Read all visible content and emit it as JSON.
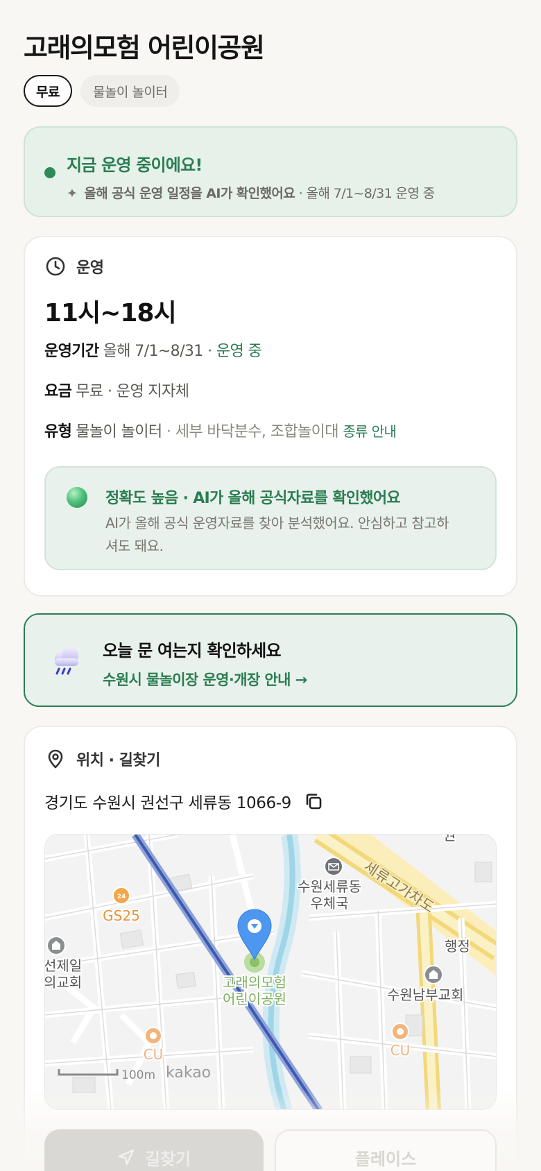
{
  "park": {
    "title": "고래의모험 어린이공원",
    "chips": [
      "무료",
      "물놀이 놀이터"
    ]
  },
  "status": {
    "title": "지금 운영 중이에요!",
    "sparkle": "✦",
    "sub_bold": "올해 공식 운영 일정을 AI가 확인했어요",
    "sub_rest": " · 올해 7/1~8/31 운영 중"
  },
  "operation": {
    "section_label": "운영",
    "hours": "11시~18시",
    "period_key": "운영기간",
    "period_value": "올해 7/1~8/31",
    "period_status": " · 운영 중",
    "fee_key": "요금",
    "fee_value": "무료 · 운영 지자체",
    "type_key": "유형",
    "type_value": "물놀이 놀이터",
    "type_detail": " · 세부 바닥분수, 조합놀이대 ",
    "type_link": "종류 안내"
  },
  "accuracy": {
    "title": "정확도 높음 · AI가 올해 공식자료를 확인했어요",
    "body": "AI가 올해 공식 운영자료를 찾아 분석했어요. 안심하고 참고하셔도 돼요."
  },
  "notice": {
    "title": "오늘 문 여는지 확인하세요",
    "link": "수원시 물놀이장 운영·개장 안내 →"
  },
  "location": {
    "section_label": "위치 · 길찾기",
    "address": "경기도 수원시 권선구 세류동 1066-9",
    "map": {
      "labels": {
        "gs25": "GS25",
        "post1": "수원세류동",
        "post2": "우체국",
        "overpass": "세류고가차도",
        "church_left1": "선제일",
        "church_left2": "의교회",
        "park1": "고래의모험",
        "park2": "어린이공원",
        "church_right": "수원남부교회",
        "cu": "CU",
        "edge_top": "권",
        "edge_right": "행정",
        "scale": "100m",
        "brand": "kakao"
      }
    }
  },
  "actions": {
    "route": "길찾기",
    "place": "플레이스"
  },
  "colors": {
    "accent": "#2a7d50",
    "status_bg": "#e6f1ea",
    "marker": "#4d97f0"
  }
}
